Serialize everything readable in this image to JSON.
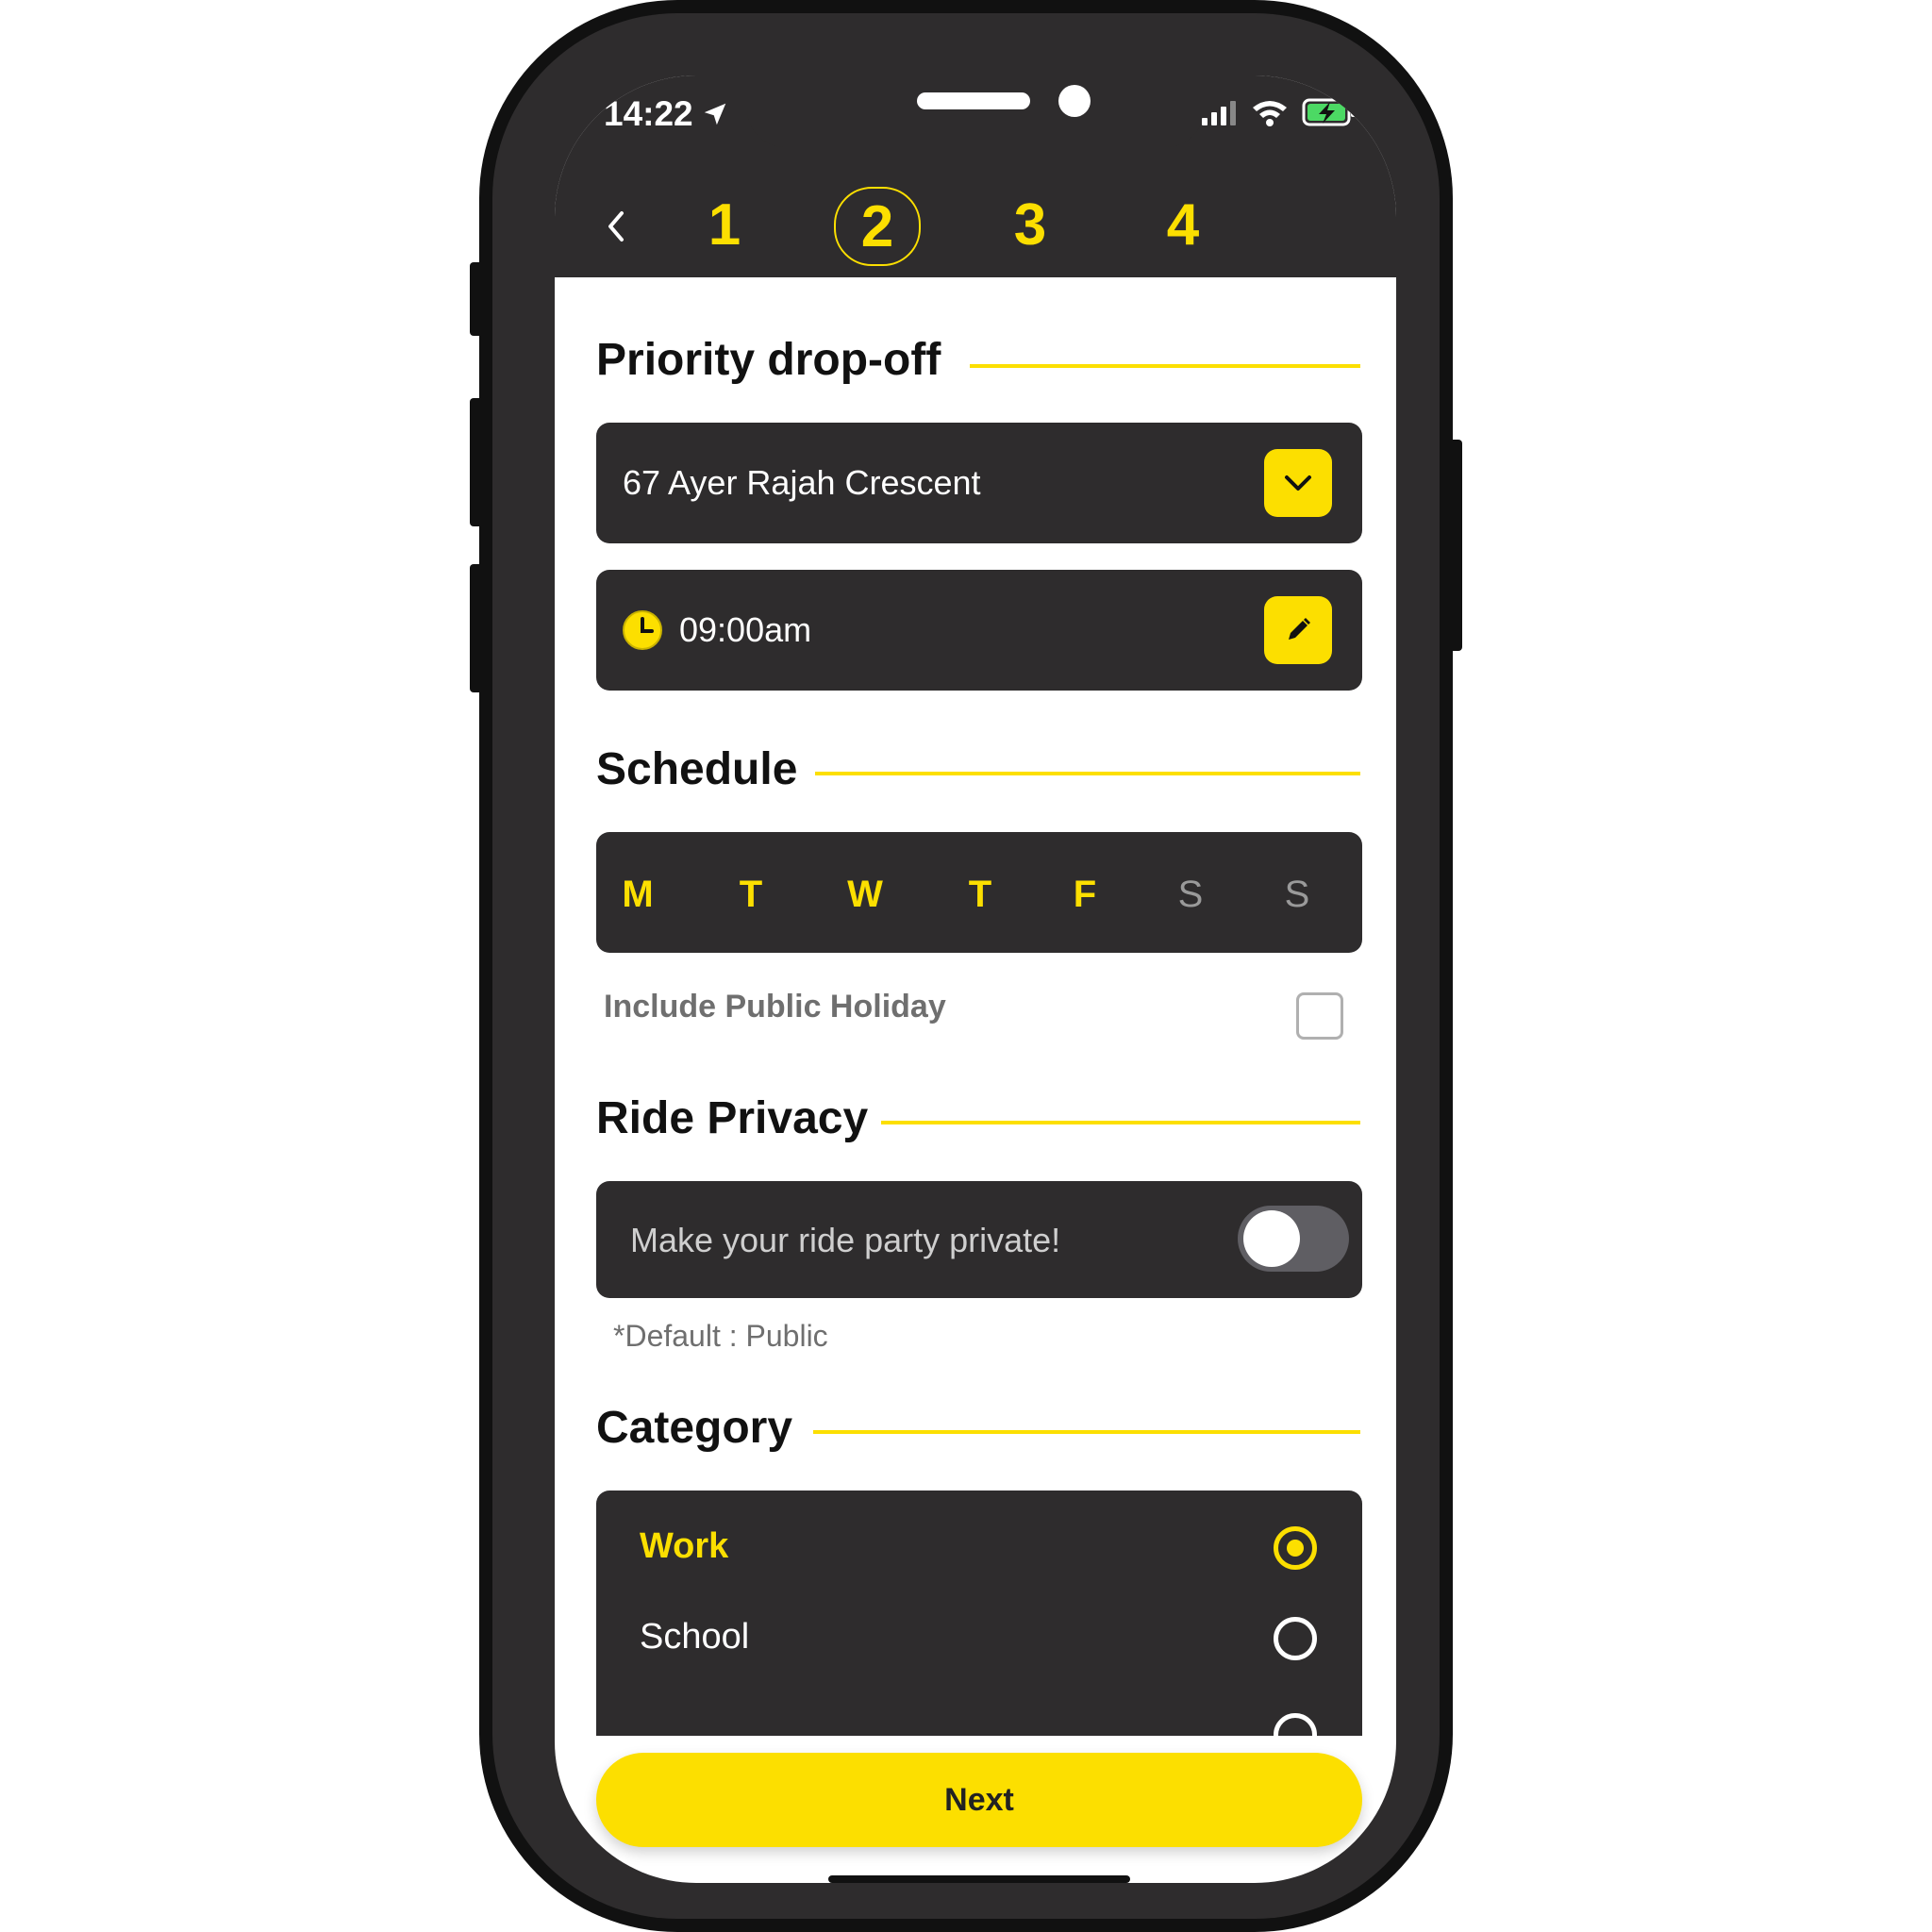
{
  "status_bar": {
    "time": "14:22"
  },
  "header": {
    "steps": [
      "1",
      "2",
      "3",
      "4"
    ],
    "active_step": "2"
  },
  "priority_dropoff": {
    "title": "Priority drop-off",
    "address": "67 Ayer Rajah Crescent",
    "time": "09:00am"
  },
  "schedule": {
    "title": "Schedule",
    "days": [
      {
        "label": "M",
        "selected": true
      },
      {
        "label": "T",
        "selected": true
      },
      {
        "label": "W",
        "selected": true
      },
      {
        "label": "T",
        "selected": true
      },
      {
        "label": "F",
        "selected": true
      },
      {
        "label": "S",
        "selected": false
      },
      {
        "label": "S",
        "selected": false
      }
    ],
    "holiday_label": "Include Public Holiday",
    "holiday_checked": false
  },
  "ride_privacy": {
    "title": "Ride Privacy",
    "toggle_label": "Make your ride party private!",
    "toggle_on": false,
    "default_note": "*Default : Public"
  },
  "category": {
    "title": "Category",
    "options": [
      {
        "label": "Work",
        "selected": true
      },
      {
        "label": "School",
        "selected": false
      }
    ]
  },
  "next_label": "Next",
  "colors": {
    "accent": "#fcdf00",
    "dark": "#2e2c2d",
    "muted": "#9a9a9a"
  }
}
